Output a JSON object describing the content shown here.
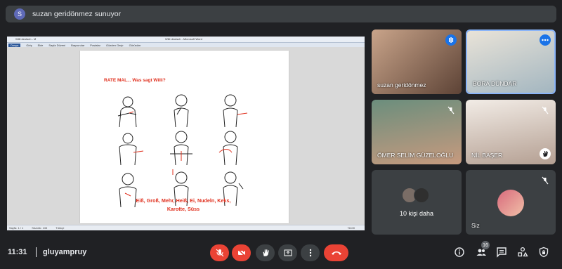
{
  "presenter": {
    "avatar_letter": "S",
    "text": "suzan geridönmez sunuyor"
  },
  "document": {
    "window_title": "Willi deutsch - M",
    "app_title": "Willi deutsch - Microsoft Word",
    "ribbon_tabs": [
      "Dosya",
      "Giriş",
      "Ekle",
      "Sayfa Düzeni",
      "Başvurular",
      "Postalar",
      "Gözden Geçir",
      "Görünüm"
    ],
    "heading": "RATE MAL... Was sagt Willi?",
    "caption_line1": "Eiß, Groß, Mehr, Heiß, Ei, Nudeln, Keks,",
    "caption_line2": "Karotte, Süss",
    "status_page": "Sayfa: 1 / 1",
    "status_words": "Sözcük: 133",
    "status_lang": "Türkçe",
    "zoom": "%100"
  },
  "participants": [
    {
      "name": "suzan geridönmez",
      "state": "speaking"
    },
    {
      "name": "BORA DÜNDAR",
      "state": "pinned"
    },
    {
      "name": "ÖMER SELİM GÜZELOĞLU",
      "state": "muted"
    },
    {
      "name": "NİL BAŞER",
      "state": "muted-hand"
    },
    {
      "more_label": "10 kişi daha"
    },
    {
      "name": "Siz",
      "state": "muted"
    }
  ],
  "bottom": {
    "time": "11:31",
    "separator": "|",
    "meeting_code": "gluyampruy",
    "people_count": "16"
  },
  "colors": {
    "accent_blue": "#8ab4f8",
    "red": "#ea4335",
    "dark": "#202124",
    "tile": "#3c4043"
  }
}
